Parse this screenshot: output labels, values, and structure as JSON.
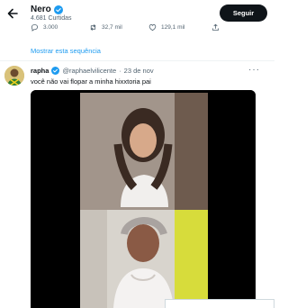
{
  "header": {
    "name": "Nero",
    "tweet_count": "4.681 Curtidas",
    "follow_label": "Seguir"
  },
  "actions": {
    "replies": "3.000",
    "retweets": "32,7 mil",
    "likes": "129,1 mil"
  },
  "thread": {
    "show_thread_label": "Mostrar esta sequência"
  },
  "tweet": {
    "author": "rapha",
    "handle": "@raphaelvilicente",
    "separator": "·",
    "date": "23 de nov",
    "more": "···",
    "text": "você não vai flopar a minha hixxtoria pai"
  },
  "colors": {
    "accent": "#1d9bf0",
    "follow_bg": "#0f1419",
    "muted": "#536471"
  },
  "icons": [
    "back-arrow-icon",
    "verified-badge-icon",
    "reply-icon",
    "retweet-icon",
    "like-icon",
    "share-icon",
    "more-icon"
  ]
}
